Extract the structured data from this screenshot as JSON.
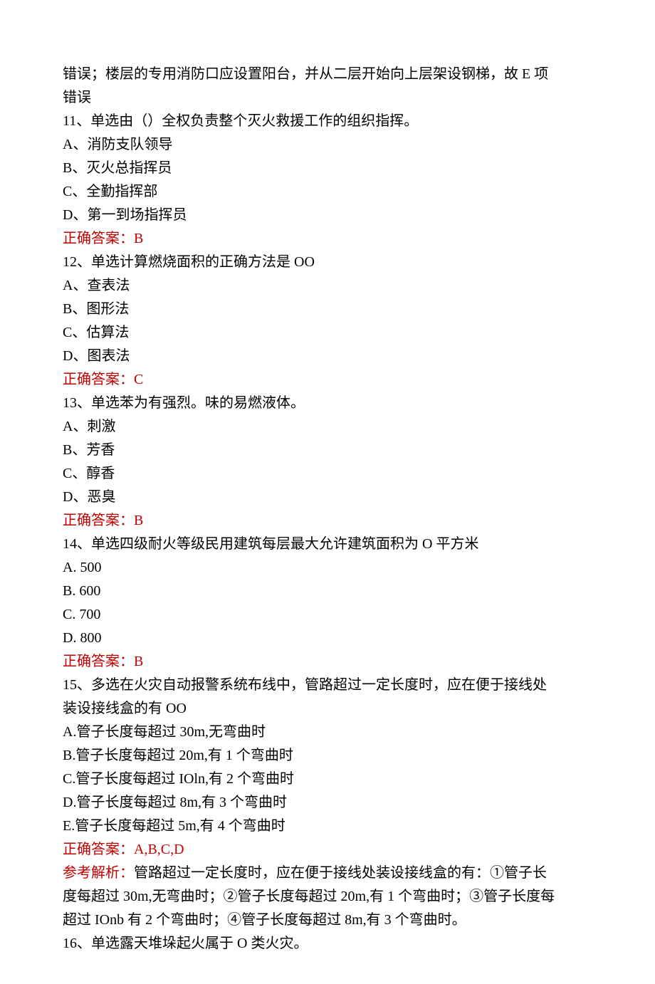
{
  "preface": [
    "错误；楼层的专用消防口应设置阳台，并从二层开始向上层架设钢梯，故 E 项",
    "错误"
  ],
  "q11": {
    "stem": "11、单选由（）全权负责整个灭火救援工作的组织指挥。",
    "opts": [
      "A、消防支队领导",
      "B、灭火总指挥员",
      "C、全勤指挥部",
      "D、第一到场指挥员"
    ],
    "answer": "正确答案：B"
  },
  "q12": {
    "stem": "12、单选计算燃烧面积的正确方法是 OO",
    "opts": [
      "A、查表法",
      "B、图形法",
      "C、估算法",
      "D、图表法"
    ],
    "answer": "正确答案：C"
  },
  "q13": {
    "stem": "13、单选苯为有强烈。味的易燃液体。",
    "opts": [
      "A、刺激",
      "B、芳香",
      "C、醇香",
      "D、恶臭"
    ],
    "answer": "正确答案：B"
  },
  "q14": {
    "stem": "14、单选四级耐火等级民用建筑每层最大允许建筑面积为 O 平方米",
    "opts": [
      "A. 500",
      "B. 600",
      "C. 700",
      "D. 800"
    ],
    "answer": "正确答案：B"
  },
  "q15": {
    "stem1": "15、多选在火灾自动报警系统布线中，管路超过一定长度时，应在便于接线处",
    "stem2": "装设接线盒的有 OO",
    "opts": [
      "A.管子长度每超过 30m,无弯曲时",
      "B.管子长度每超过 20m,有 1 个弯曲时",
      "C.管子长度每超过 IOln,有 2 个弯曲时",
      "D.管子长度每超过 8m,有 3 个弯曲时",
      "E.管子长度每超过 5m,有 4 个弯曲时"
    ],
    "answer": "正确答案：A,B,C,D",
    "analysis_label": "参考解析：",
    "analysis_body1": "管路超过一定长度时，应在便于接线处装设接线盒的有：①管子长",
    "analysis_line2": "度每超过 30m,无弯曲时；②管子长度每超过 20m,有 1 个弯曲时；③管子长度每",
    "analysis_line3": "超过 IOnb 有 2 个弯曲时；④管子长度每超过 8m,有 3 个弯曲时。"
  },
  "q16": {
    "stem": "16、单选露天堆垛起火属于 O 类火灾。"
  }
}
